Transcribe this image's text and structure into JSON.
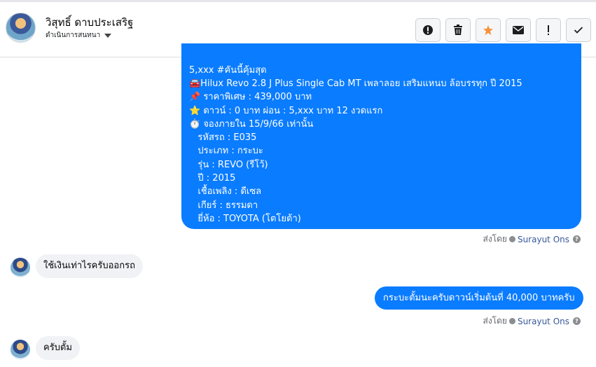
{
  "header": {
    "contact_name": "วิสุทธิ์ ดาบประเสริฐ",
    "conversation_actions_label": "ดำเนินการสนทนา",
    "toolbar": [
      {
        "name": "report-icon",
        "color": "#050505"
      },
      {
        "name": "trash-icon",
        "color": "#050505"
      },
      {
        "name": "star-icon",
        "color": "#f7923b"
      },
      {
        "name": "envelope-icon",
        "color": "#050505"
      },
      {
        "name": "exclamation-icon",
        "color": "#050505"
      },
      {
        "name": "check-icon",
        "color": "#050505"
      }
    ]
  },
  "messages": {
    "outgoing_long": {
      "lines": [
        "5,xxx #คันนี้คุ้มสุด",
        "🚘Hilux Revo 2.8 J Plus Single Cab MT เพลาลอย เสริมแหนบ ล้อบรรทุก ปี 2015",
        "📌 ราคาพิเศษ : 439,000 บาท",
        "⭐ ดาวน์ : 0 บาท ผ่อน : 5,xxx บาท 12 งวดแรก",
        "⏱️ จองภายใน 15/9/66 เท่านั้น",
        "   รหัสรถ : E035",
        "   ประเภท : กระบะ",
        "   รุ่น : REVO (รีโว้)",
        "   ปี : 2015",
        "   เชื้อเพลิง : ดีเซล",
        "   เกียร์ : ธรรมดา",
        "   ยี่ห้อ : TOYOTA (โตโยต้า)"
      ],
      "sent_by_prefix": "ส่งโดย",
      "sent_by_name": "Surayut Ons"
    },
    "incoming_1": "ใช้เงินเท่าไรครับออกรถ",
    "outgoing_2": {
      "text": "กระบะตั้มนะครับดาวน์เริ่มต้นที่ 40,000 บาทครับ",
      "sent_by_prefix": "ส่งโดย",
      "sent_by_name": "Surayut Ons"
    },
    "incoming_2": "ครับตั้ม",
    "accent_color": "#0a7cff"
  }
}
